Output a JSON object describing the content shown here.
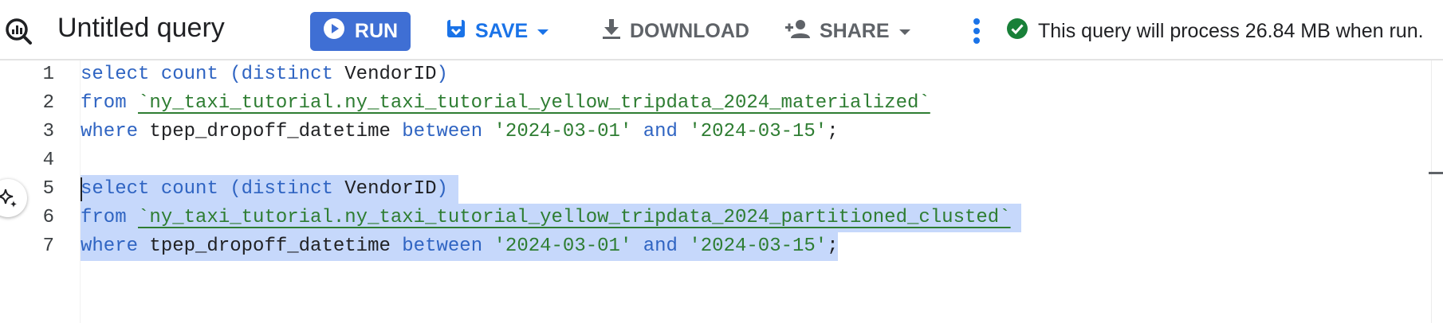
{
  "toolbar": {
    "logo_icon": "bigquery-icon",
    "title": "Untitled query",
    "run_label": "RUN",
    "save_label": "SAVE",
    "download_label": "DOWNLOAD",
    "share_label": "SHARE",
    "status_text": "This query will process 26.84 MB when run.",
    "colors": {
      "run_bg": "#3f6fd4",
      "save": "#1a73e8",
      "status_ok": "#188038"
    }
  },
  "editor": {
    "line_numbers": [
      "1",
      "2",
      "3",
      "4",
      "5",
      "6",
      "7"
    ],
    "lines": [
      {
        "kw1": "select",
        "kw2": "count",
        "kw3": "(distinct",
        "ident": "VendorID",
        "close": ")"
      },
      {
        "kw": "from",
        "table": "`ny_taxi_tutorial.ny_taxi_tutorial_yellow_tripdata_2024_materialized`"
      },
      {
        "kw": "where",
        "col": "tpep_dropoff_datetime",
        "between": "between",
        "d1": "'2024-03-01'",
        "and": "and",
        "d2": "'2024-03-15'",
        "semi": ";"
      },
      {},
      {
        "kw1": "select",
        "kw2": "count",
        "kw3": "(distinct",
        "ident": "VendorID",
        "close": ")"
      },
      {
        "kw": "from",
        "table": "`ny_taxi_tutorial.ny_taxi_tutorial_yellow_tripdata_2024_partitioned_clusted`"
      },
      {
        "kw": "where",
        "col": "tpep_dropoff_datetime",
        "between": "between",
        "d1": "'2024-03-01'",
        "and": "and",
        "d2": "'2024-03-15'",
        "semi": ";"
      }
    ],
    "selection_color": "#c6d8fb"
  }
}
